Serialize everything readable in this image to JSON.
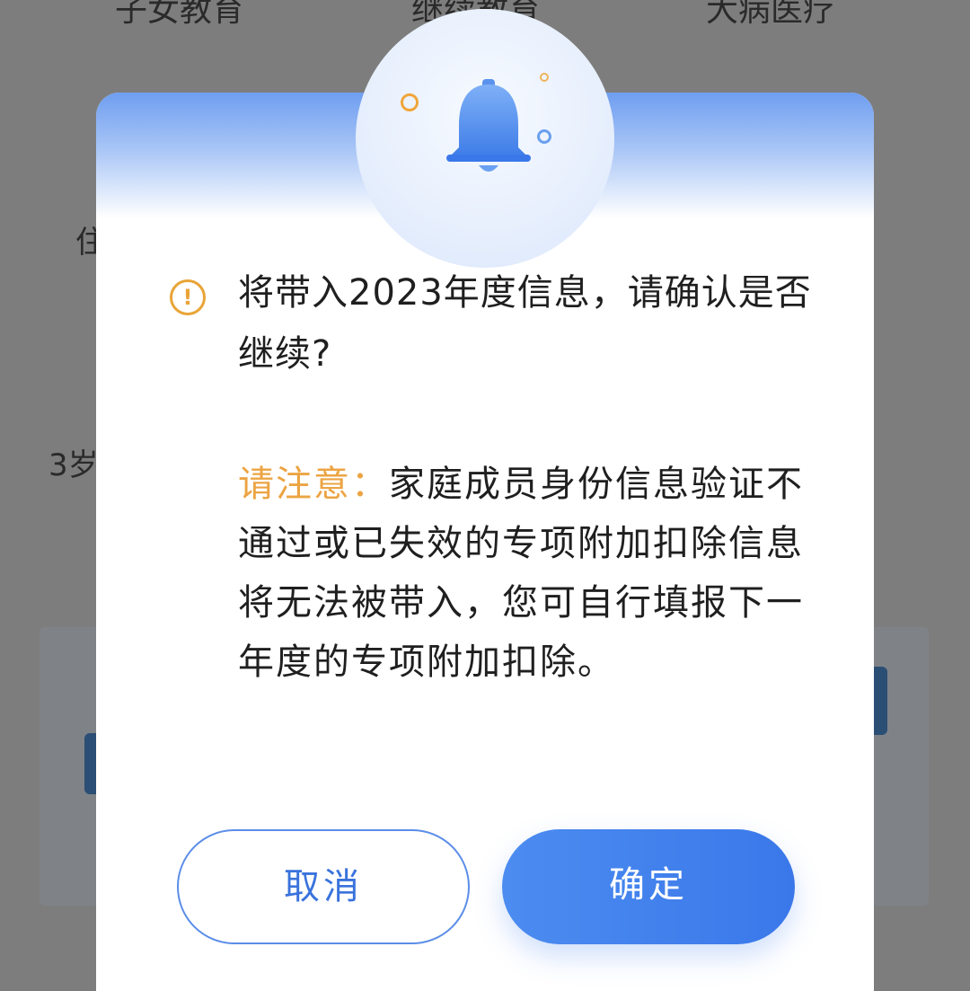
{
  "background": {
    "tabs": [
      "子女教育",
      "继续教育",
      "大病医疗"
    ],
    "side_text_1": "住",
    "side_text_2": "3岁"
  },
  "dialog": {
    "message": "将带入2023年度信息，请确认是否继续?",
    "note_label": "请注意：",
    "note_text": "家庭成员身份信息验证不通过或已失效的专项附加扣除信息将无法被带入，您可自行填报下一年度的专项附加扣除。",
    "cancel_label": "取消",
    "confirm_label": "确定"
  },
  "colors": {
    "accent_blue": "#3a78ea",
    "warning_orange": "#e9a437"
  },
  "icons": {
    "header": "bell-icon",
    "message": "warning-circle-icon"
  }
}
